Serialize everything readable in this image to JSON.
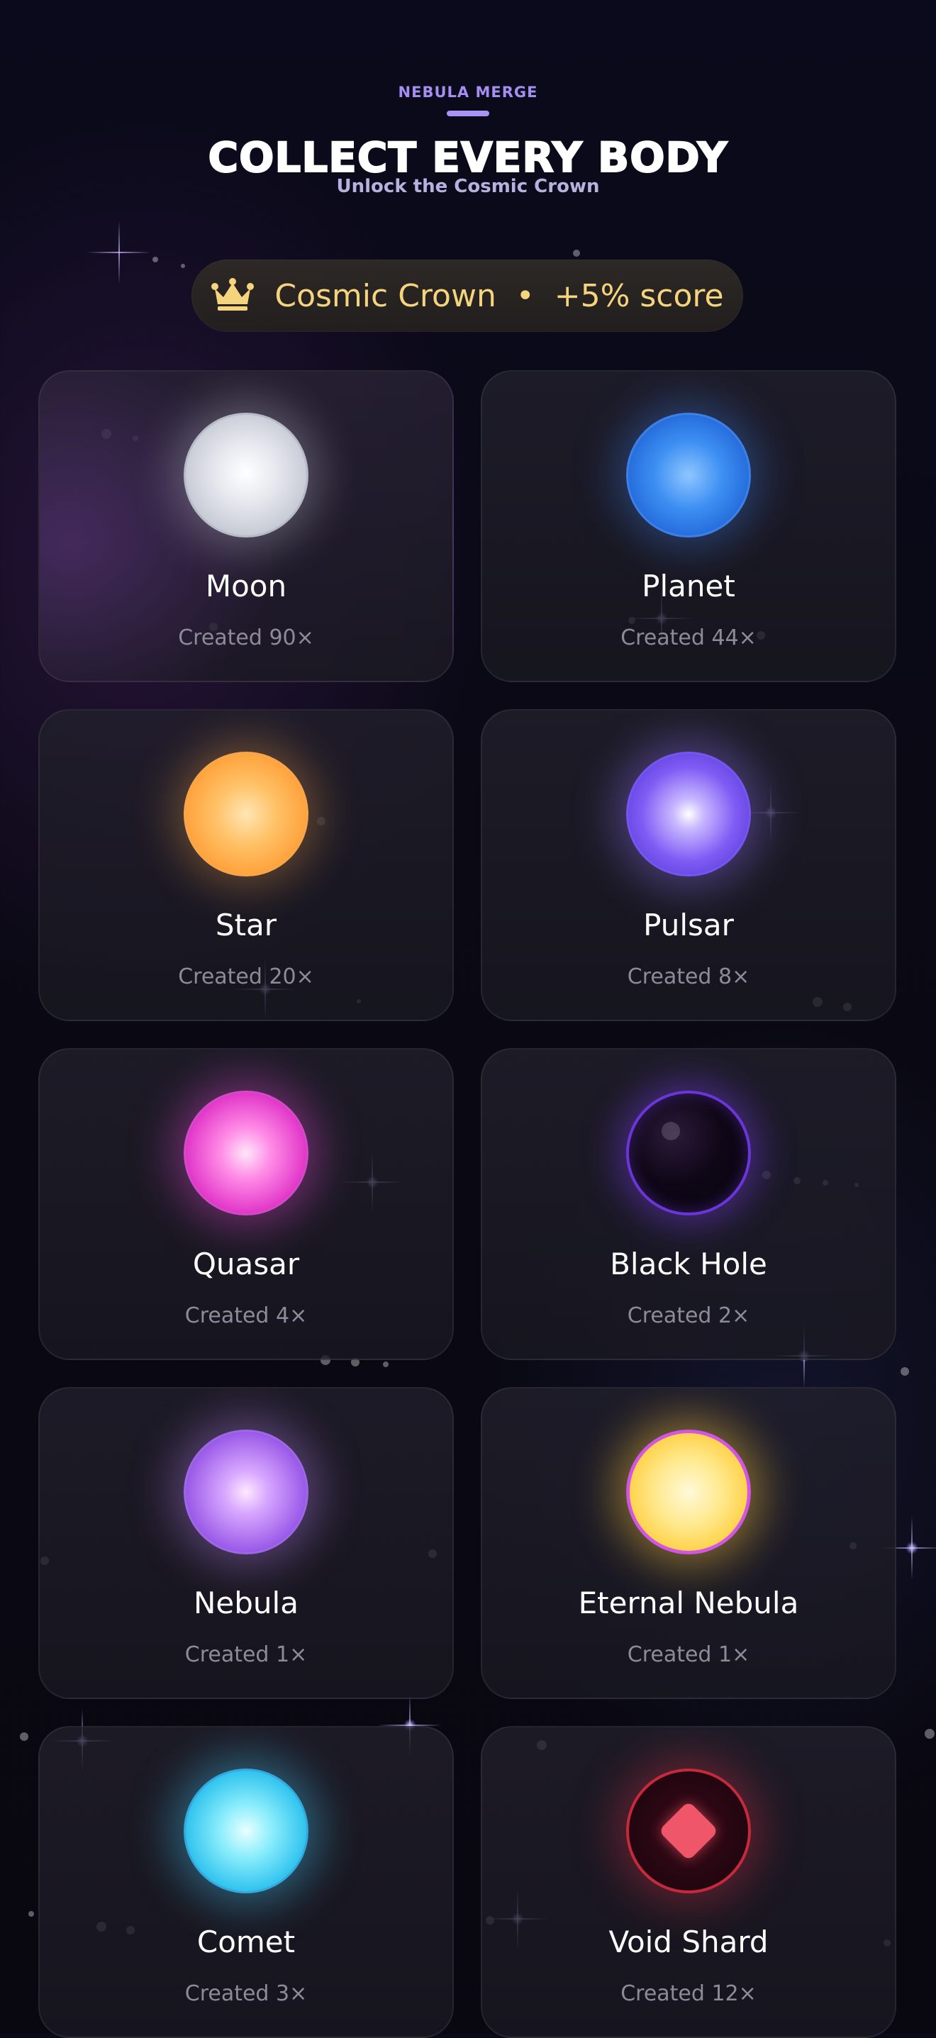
{
  "header": {
    "eyebrow": "NEBULA MERGE",
    "title": "COLLECT EVERY BODY",
    "subtitle": "Unlock the Cosmic Crown"
  },
  "reward": {
    "icon": "crown-icon",
    "label": "Cosmic Crown  •  +5% score",
    "color": "#f5d47e"
  },
  "bodies": [
    {
      "name": "Moon",
      "count": "Created 90×",
      "color": "#e6e8ee"
    },
    {
      "name": "Planet",
      "count": "Created 44×",
      "color": "#3d8ff3"
    },
    {
      "name": "Star",
      "count": "Created 20×",
      "color": "#ffb050"
    },
    {
      "name": "Pulsar",
      "count": "Created 8×",
      "color": "#7f5cf4"
    },
    {
      "name": "Quasar",
      "count": "Created 4×",
      "color": "#e238c9"
    },
    {
      "name": "Black Hole",
      "count": "Created 2×",
      "color": "#6a36d8"
    },
    {
      "name": "Nebula",
      "count": "Created 1×",
      "color": "#9a5ae8"
    },
    {
      "name": "Eternal Nebula",
      "count": "Created 1×",
      "color": "#ffd24a"
    },
    {
      "name": "Comet",
      "count": "Created 3×",
      "color": "#32c4ef"
    },
    {
      "name": "Void Shard",
      "count": "Created 12×",
      "color": "#f0566a"
    }
  ]
}
